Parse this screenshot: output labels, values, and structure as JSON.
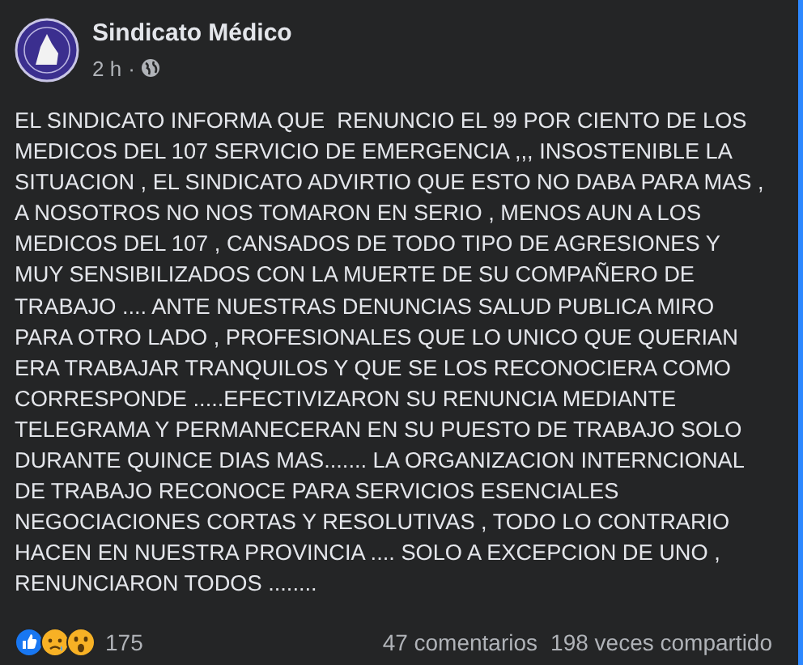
{
  "post": {
    "author": "Sindicato Médico",
    "time": "2 h",
    "separator": "·",
    "text": "EL SINDICATO INFORMA QUE  RENUNCIO EL 99 POR CIENTO DE LOS MEDICOS DEL 107 SERVICIO DE EMERGENCIA ,,, INSOSTENIBLE LA SITUACION , EL SINDICATO ADVIRTIO QUE ESTO NO DABA PARA MAS , A NOSOTROS NO NOS TOMARON EN SERIO , MENOS AUN A LOS MEDICOS DEL 107 , CANSADOS DE TODO TIPO DE AGRESIONES Y MUY SENSIBILIZADOS CON LA MUERTE DE SU COMPAÑERO DE TRABAJO .... ANTE NUESTRAS DENUNCIAS SALUD PUBLICA MIRO PARA OTRO LADO , PROFESIONALES QUE LO UNICO QUE QUERIAN ERA TRABAJAR TRANQUILOS Y QUE SE LOS RECONOCIERA COMO CORRESPONDE .....EFECTIVIZARON SU RENUNCIA MEDIANTE TELEGRAMA Y PERMANECERAN EN SU PUESTO DE TRABAJO SOLO DURANTE QUINCE DIAS MAS....... LA ORGANIZACION INTERNCIONAL DE TRABAJO RECONOCE PARA SERVICIOS ESENCIALES NEGOCIACIONES CORTAS Y RESOLUTIVAS , TODO LO CONTRARIO HACEN EN NUESTRA PROVINCIA .... SOLO A EXCEPCION DE UNO , RENUNCIARON TODOS ........",
    "reactions": [
      {
        "kind": "like"
      },
      {
        "kind": "sad"
      },
      {
        "kind": "wow"
      }
    ],
    "reaction_count": "175",
    "comments": "47 comentarios",
    "shares": "198 veces compartido"
  }
}
